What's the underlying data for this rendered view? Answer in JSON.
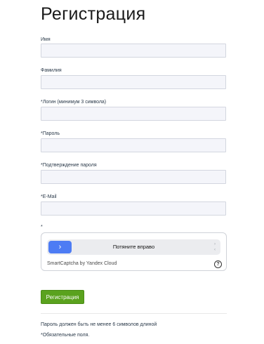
{
  "title": "Регистрация",
  "fields": {
    "name": {
      "label": "Имя",
      "value": ""
    },
    "surname": {
      "label": "Фамилия",
      "value": ""
    },
    "login": {
      "label": "*Логин (минимум 3 символа)",
      "value": ""
    },
    "password": {
      "label": "*Пароль",
      "value": ""
    },
    "password_confirm": {
      "label": "*Подтверждение пароля",
      "value": ""
    },
    "email": {
      "label": "*E-Mail",
      "value": ""
    }
  },
  "captcha": {
    "required_marker": "*",
    "slider_text": "Потяните вправо",
    "knob_icon": "chevron-right-icon",
    "footer": "SmartCaptcha by Yandex Cloud",
    "help_icon": "question-circle-icon"
  },
  "submit_label": "Регистрация",
  "notes": {
    "password_rule": "Пароль должен быть не менее 6 символов длиной",
    "required_fields": "*Обязательные поля."
  },
  "colors": {
    "button": "#5aa21e",
    "slider_knob": "#4d7cf4",
    "field_bg": "#f4f5fa"
  }
}
